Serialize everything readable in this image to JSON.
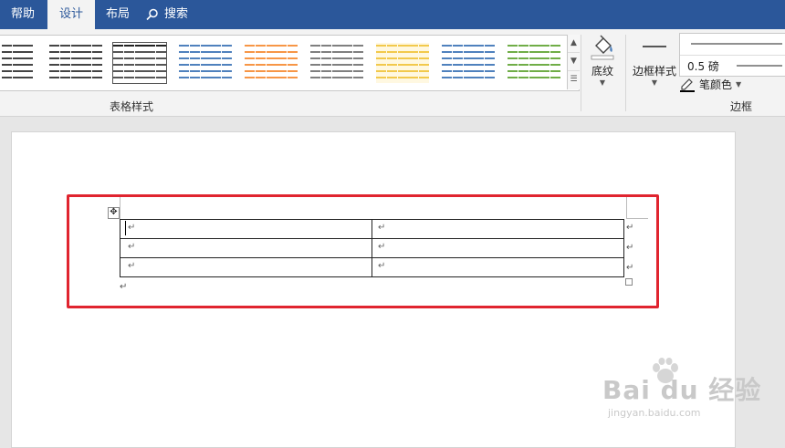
{
  "tabs": [
    {
      "label": "帮助",
      "active": false
    },
    {
      "label": "设计",
      "active": true
    },
    {
      "label": "布局",
      "active": false
    },
    {
      "label": "搜索",
      "active": false
    }
  ],
  "ribbon": {
    "table_styles_group": "表格样式",
    "shading_label": "底纹",
    "border_styles_label": "边框样式",
    "weight_value": "0.5 磅",
    "pen_color_label": "笔颜色",
    "borders_group": "边框"
  },
  "gallery_colors": [
    "#444444",
    "#444444",
    "#555555",
    "#4f81bd",
    "#f79646",
    "#7f7f7f",
    "#f2c94c",
    "#4f81bd",
    "#70ad47"
  ],
  "document": {
    "table": {
      "rows": 3,
      "cols": 2
    }
  },
  "watermark": {
    "brand": "Bai du 经验",
    "url": "jingyan.baidu.com"
  },
  "accent": "#2b579a",
  "highlight": "#e0242f"
}
